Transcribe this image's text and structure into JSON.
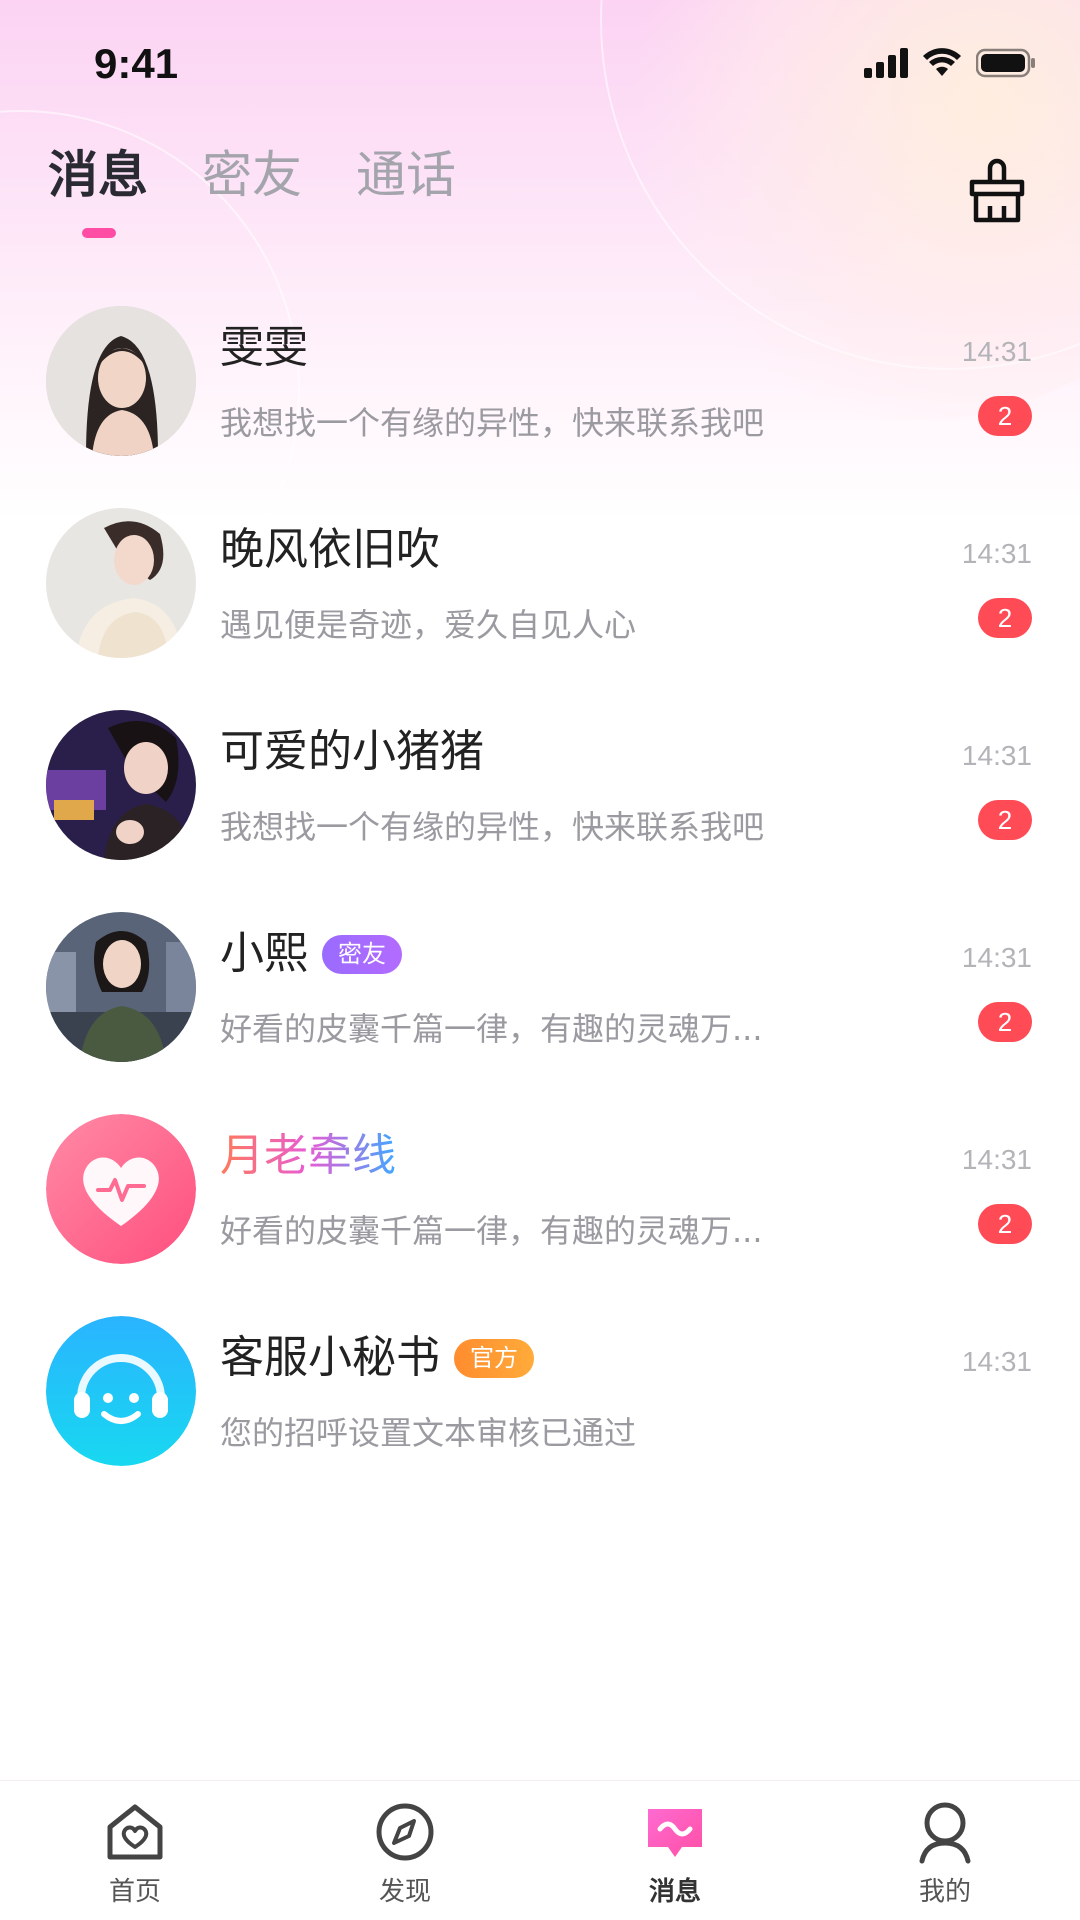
{
  "status_bar": {
    "time": "9:41"
  },
  "tabs": [
    {
      "label": "消息",
      "active": true
    },
    {
      "label": "密友",
      "active": false
    },
    {
      "label": "通话",
      "active": false
    }
  ],
  "chats": [
    {
      "name": "雯雯",
      "preview": "我想找一个有缘的异性，快来联系我吧",
      "time": "14:31",
      "badge": "2",
      "tag": ""
    },
    {
      "name": "晚风依旧吹",
      "preview": "遇见便是奇迹，爱久自见人心",
      "time": "14:31",
      "badge": "2",
      "tag": ""
    },
    {
      "name": "可爱的小猪猪",
      "preview": "我想找一个有缘的异性，快来联系我吧",
      "time": "14:31",
      "badge": "2",
      "tag": ""
    },
    {
      "name": "小熙",
      "preview": "好看的皮囊千篇一律，有趣的灵魂万...",
      "time": "14:31",
      "badge": "2",
      "tag": "密友"
    },
    {
      "name": "月老牵线",
      "preview": "好看的皮囊千篇一律，有趣的灵魂万...",
      "time": "14:31",
      "badge": "2",
      "tag": ""
    },
    {
      "name": "客服小秘书",
      "preview": "您的招呼设置文本审核已通过",
      "time": "14:31",
      "badge": "",
      "tag": "官方"
    }
  ],
  "bottom_nav": [
    {
      "label": "首页",
      "icon": "home-heart-icon",
      "active": false
    },
    {
      "label": "发现",
      "icon": "compass-icon",
      "active": false
    },
    {
      "label": "消息",
      "icon": "message-icon",
      "active": true
    },
    {
      "label": "我的",
      "icon": "profile-icon",
      "active": false
    }
  ],
  "colors": {
    "accent_pink": "#ff4da6",
    "badge_red": "#ff4b55",
    "tag_purple": "#9a6bff",
    "tag_orange": "#ff8c2e"
  }
}
